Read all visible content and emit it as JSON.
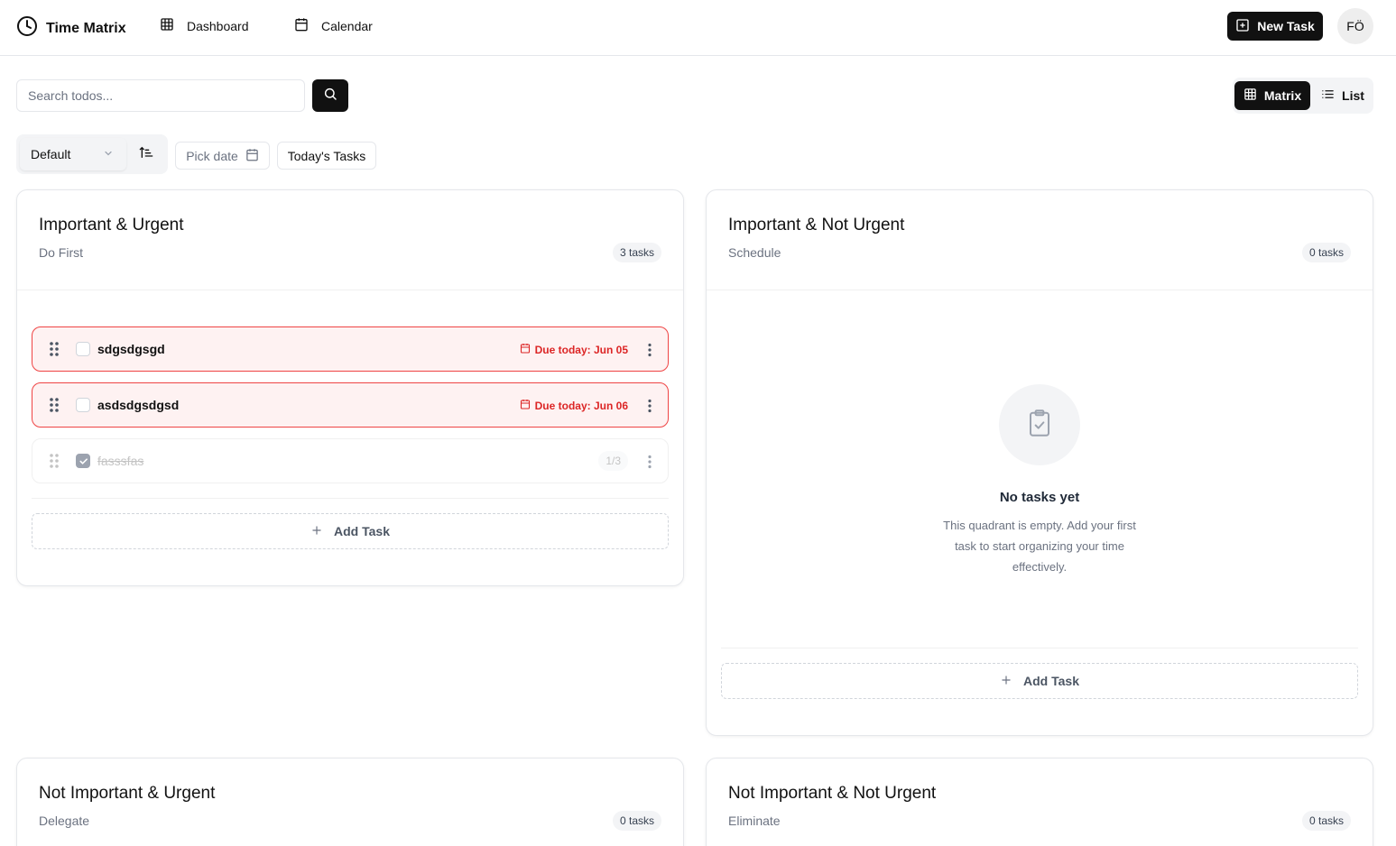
{
  "header": {
    "app_title": "Time Matrix",
    "nav": [
      {
        "label": "Dashboard",
        "icon": "grid-icon"
      },
      {
        "label": "Calendar",
        "icon": "calendar-icon"
      }
    ],
    "new_task_label": "New Task",
    "avatar_initials": "FÖ"
  },
  "search": {
    "placeholder": "Search todos...",
    "value": ""
  },
  "view_toggle": {
    "matrix_label": "Matrix",
    "list_label": "List",
    "active": "Matrix"
  },
  "filters": {
    "sort_value": "Default",
    "pick_date_label": "Pick date",
    "today_label": "Today's Tasks"
  },
  "quadrants": [
    {
      "title": "Important & Urgent",
      "subtitle": "Do First",
      "count": "3 tasks",
      "tasks": [
        {
          "title": "sdgsdgsgd",
          "due": "Due today: Jun 05",
          "completed": false
        },
        {
          "title": "asdsdgsdgsd",
          "due": "Due today: Jun 06",
          "completed": false
        },
        {
          "title": "fasssfas",
          "subtasks": "1/3",
          "completed": true
        }
      ],
      "add_label": "Add Task"
    },
    {
      "title": "Important & Not Urgent",
      "subtitle": "Schedule",
      "count": "0 tasks",
      "empty_title": "No tasks yet",
      "empty_text": "This quadrant is empty. Add your first task to start organizing your time effectively.",
      "add_label": "Add Task"
    },
    {
      "title": "Not Important & Urgent",
      "subtitle": "Delegate",
      "count": "0 tasks"
    },
    {
      "title": "Not Important & Not Urgent",
      "subtitle": "Eliminate",
      "count": "0 tasks"
    }
  ],
  "colors": {
    "accent": "#111111",
    "overdue_border": "#ef4444",
    "overdue_bg": "#fef2f2",
    "overdue_text": "#dc2626"
  }
}
